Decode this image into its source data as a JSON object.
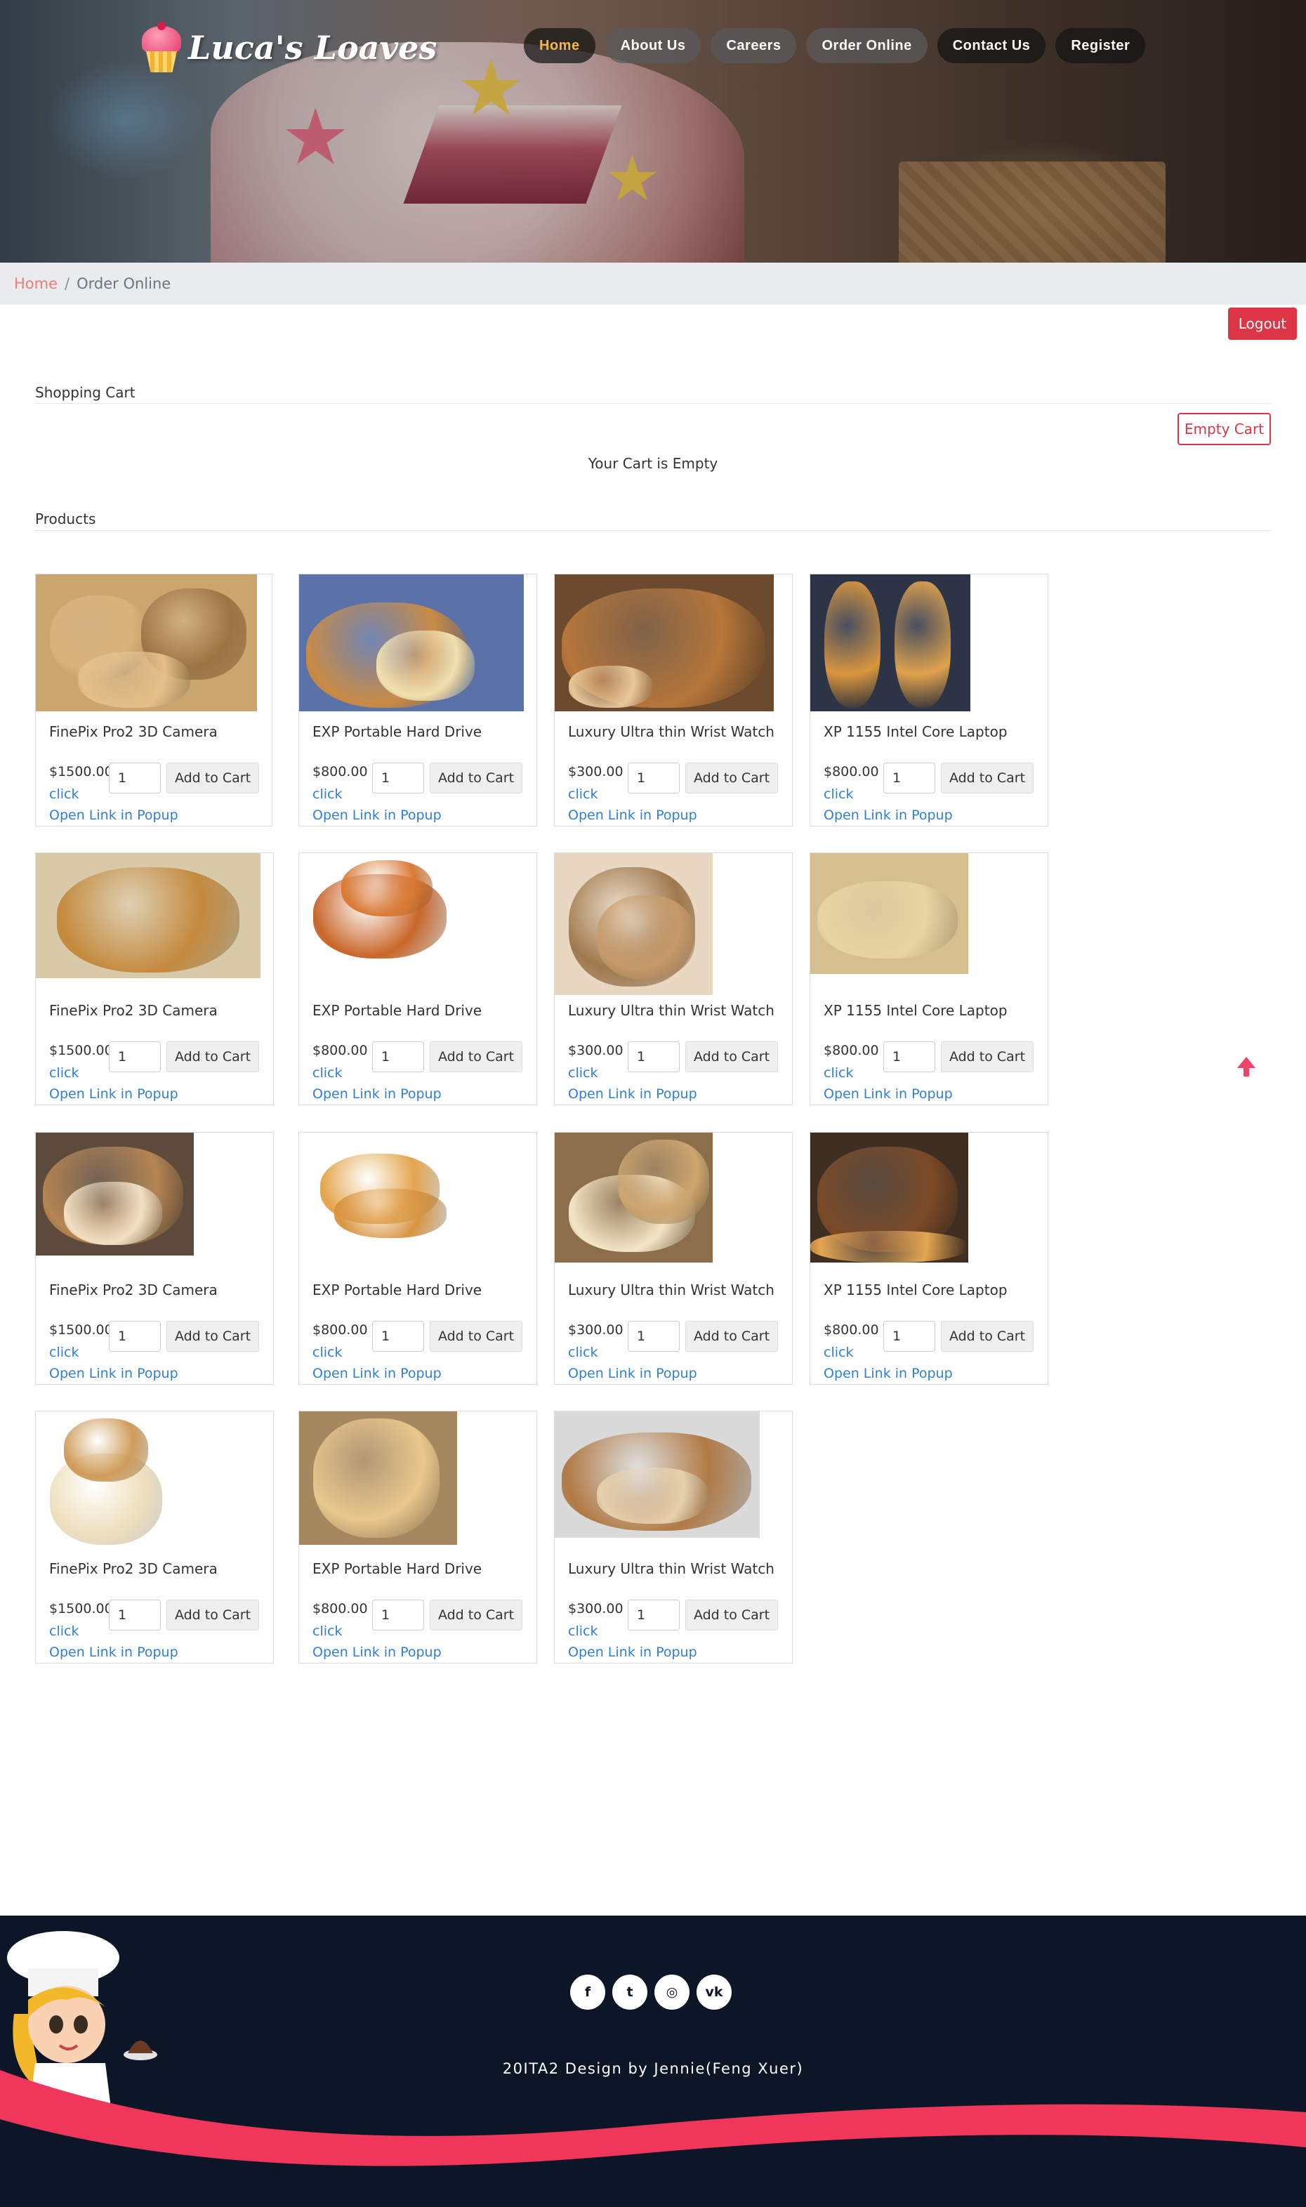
{
  "header": {
    "logo_text": "Luca's Loaves",
    "nav": [
      {
        "label": "Home",
        "active": true
      },
      {
        "label": "About Us"
      },
      {
        "label": "Careers"
      },
      {
        "label": "Order Online"
      },
      {
        "label": "Contact Us"
      },
      {
        "label": "Register"
      }
    ]
  },
  "breadcrumb": {
    "home": "Home",
    "separator": "/",
    "current": "Order Online"
  },
  "logout_label": "Logout",
  "cart": {
    "title": "Shopping Cart",
    "empty_button": "Empty Cart",
    "empty_message": "Your Cart is Empty"
  },
  "products_title": "Products",
  "products": [
    {
      "name": "FinePix Pro2 3D Camera",
      "price": "$1500.00",
      "qty": "1",
      "add_label": "Add to Cart",
      "click_label": "click",
      "popup_label": "Open Link in Popup"
    },
    {
      "name": "EXP Portable Hard Drive",
      "price": "$800.00",
      "qty": "1",
      "add_label": "Add to Cart",
      "click_label": "click",
      "popup_label": "Open Link in Popup"
    },
    {
      "name": "Luxury Ultra thin Wrist Watch",
      "price": "$300.00",
      "qty": "1",
      "add_label": "Add to Cart",
      "click_label": "click",
      "popup_label": "Open Link in Popup"
    },
    {
      "name": "XP 1155 Intel Core Laptop",
      "price": "$800.00",
      "qty": "1",
      "add_label": "Add to Cart",
      "click_label": "click",
      "popup_label": "Open Link in Popup"
    },
    {
      "name": "FinePix Pro2 3D Camera",
      "price": "$1500.00",
      "qty": "1",
      "add_label": "Add to Cart",
      "click_label": "click",
      "popup_label": "Open Link in Popup"
    },
    {
      "name": "EXP Portable Hard Drive",
      "price": "$800.00",
      "qty": "1",
      "add_label": "Add to Cart",
      "click_label": "click",
      "popup_label": "Open Link in Popup"
    },
    {
      "name": "Luxury Ultra thin Wrist Watch",
      "price": "$300.00",
      "qty": "1",
      "add_label": "Add to Cart",
      "click_label": "click",
      "popup_label": "Open Link in Popup"
    },
    {
      "name": "XP 1155 Intel Core Laptop",
      "price": "$800.00",
      "qty": "1",
      "add_label": "Add to Cart",
      "click_label": "click",
      "popup_label": "Open Link in Popup"
    },
    {
      "name": "FinePix Pro2 3D Camera",
      "price": "$1500.00",
      "qty": "1",
      "add_label": "Add to Cart",
      "click_label": "click",
      "popup_label": "Open Link in Popup"
    },
    {
      "name": "EXP Portable Hard Drive",
      "price": "$800.00",
      "qty": "1",
      "add_label": "Add to Cart",
      "click_label": "click",
      "popup_label": "Open Link in Popup"
    },
    {
      "name": "Luxury Ultra thin Wrist Watch",
      "price": "$300.00",
      "qty": "1",
      "add_label": "Add to Cart",
      "click_label": "click",
      "popup_label": "Open Link in Popup"
    },
    {
      "name": "XP 1155 Intel Core Laptop",
      "price": "$800.00",
      "qty": "1",
      "add_label": "Add to Cart",
      "click_label": "click",
      "popup_label": "Open Link in Popup"
    },
    {
      "name": "FinePix Pro2 3D Camera",
      "price": "$1500.00",
      "qty": "1",
      "add_label": "Add to Cart",
      "click_label": "click",
      "popup_label": "Open Link in Popup"
    },
    {
      "name": "EXP Portable Hard Drive",
      "price": "$800.00",
      "qty": "1",
      "add_label": "Add to Cart",
      "click_label": "click",
      "popup_label": "Open Link in Popup"
    },
    {
      "name": "Luxury Ultra thin Wrist Watch",
      "price": "$300.00",
      "qty": "1",
      "add_label": "Add to Cart",
      "click_label": "click",
      "popup_label": "Open Link in Popup"
    }
  ],
  "footer": {
    "social": [
      {
        "icon": "facebook-icon",
        "glyph": "f"
      },
      {
        "icon": "twitter-icon",
        "glyph": "t"
      },
      {
        "icon": "dribbble-icon",
        "glyph": "◎"
      },
      {
        "icon": "vk-icon",
        "glyph": "vk"
      }
    ],
    "credit": "20ITA2 Design by Jennie(Feng Xuer)"
  },
  "colors": {
    "accent": "#dc3545",
    "link": "#2f7fd6",
    "nav_active": "#f5b642",
    "footer_bg": "#0d1627",
    "footer_wave": "#f0365a"
  }
}
